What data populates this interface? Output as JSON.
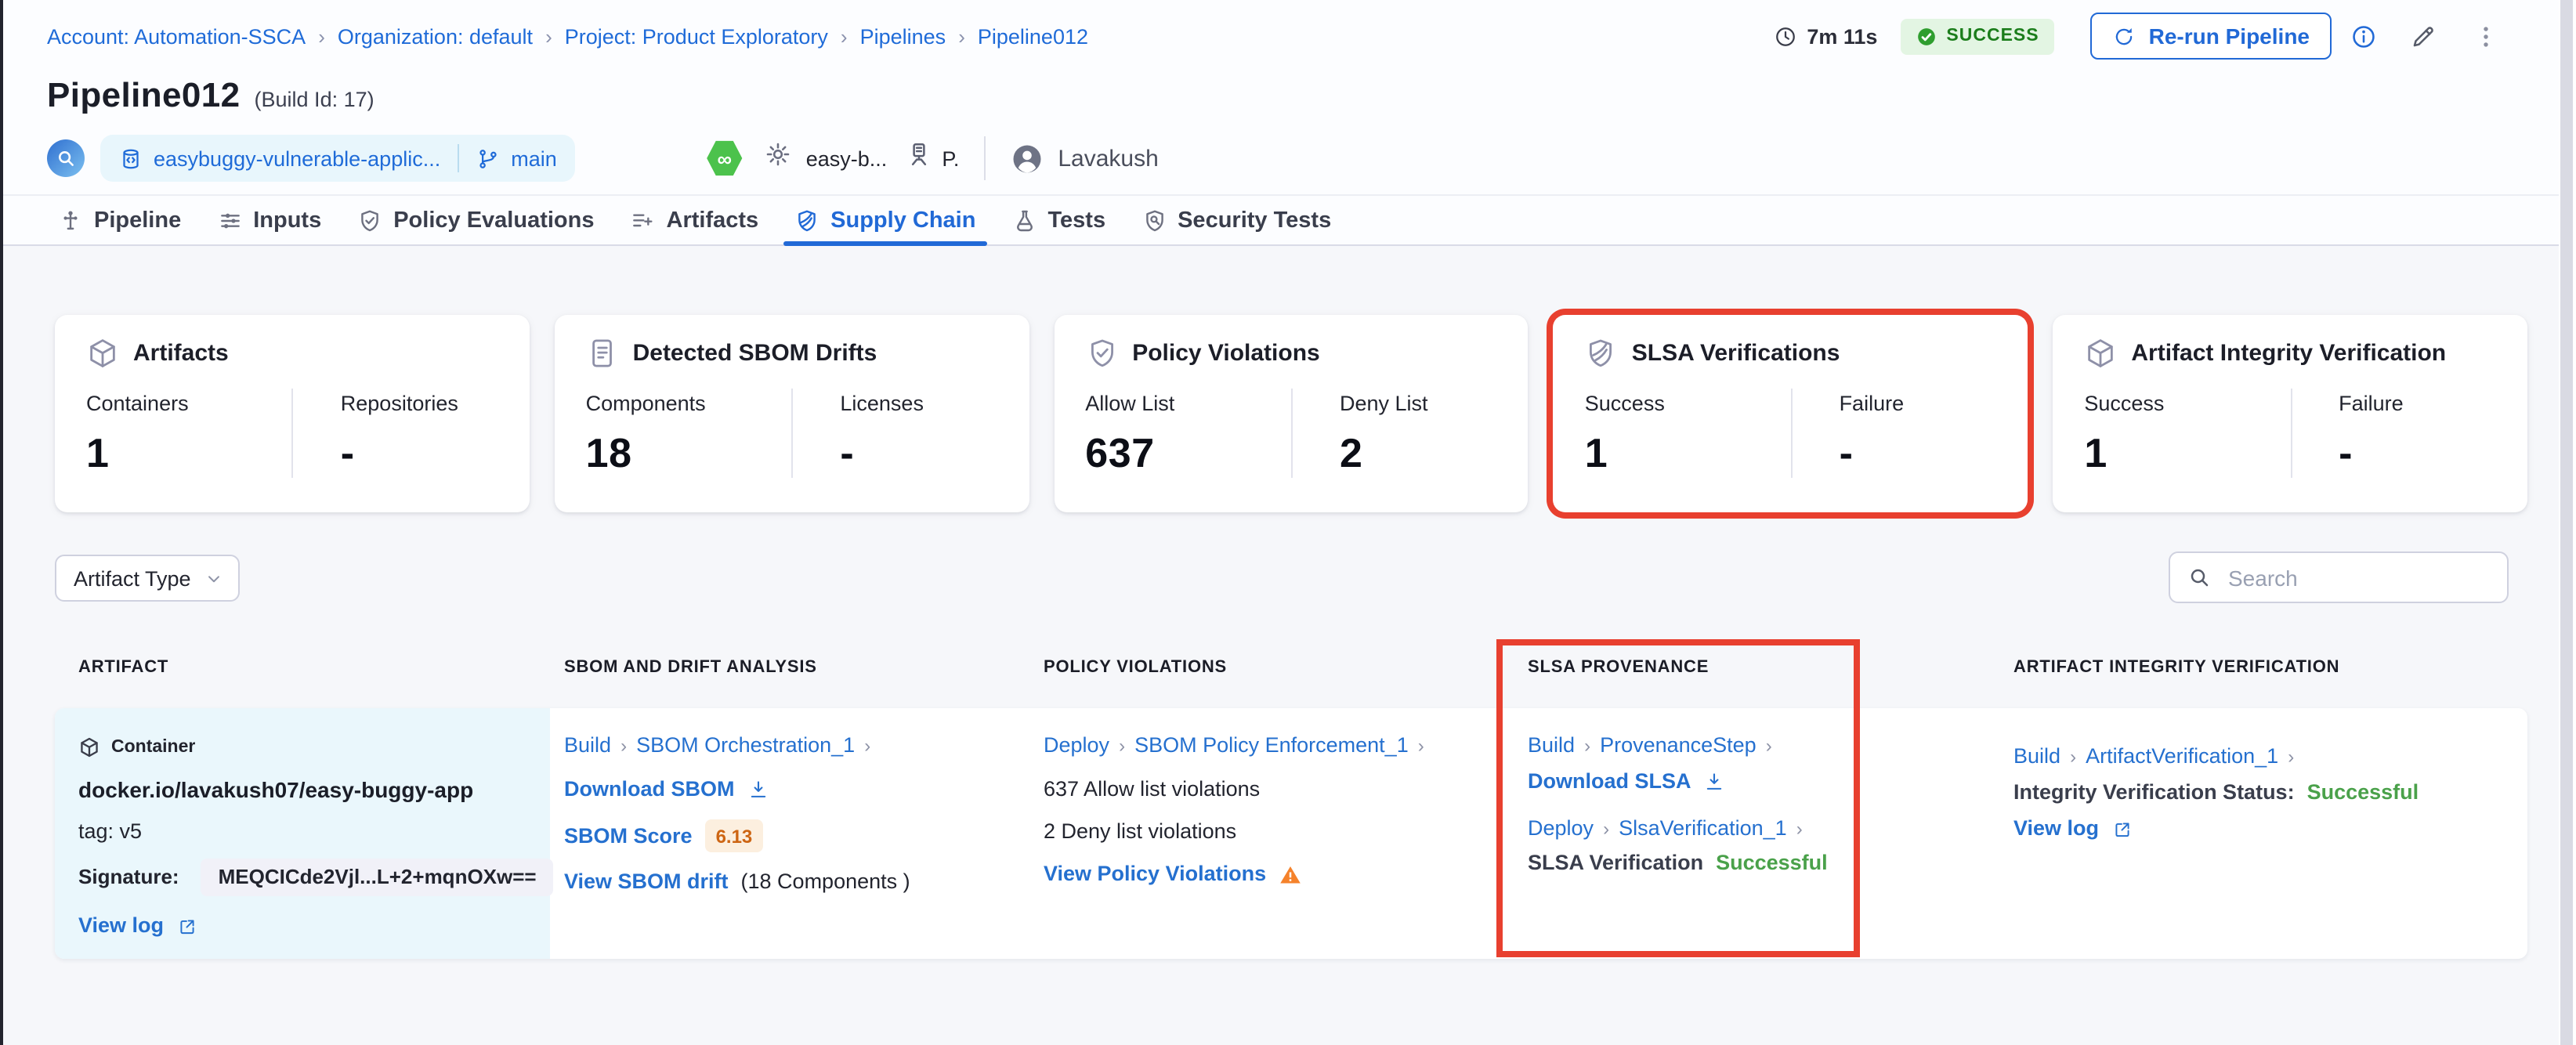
{
  "breadcrumb": {
    "separator": "›",
    "items": [
      {
        "label": "Account: Automation-SSCA"
      },
      {
        "label": "Organization: default"
      },
      {
        "label": "Project: Product Exploratory"
      },
      {
        "label": "Pipelines"
      },
      {
        "label": "Pipeline012"
      }
    ]
  },
  "topbar": {
    "duration": "7m 11s",
    "status_badge": "SUCCESS",
    "rerun_label": "Re-run Pipeline"
  },
  "header": {
    "title": "Pipeline012",
    "build_id": "(Build Id: 17)",
    "repo_name": "easybuggy-vulnerable-applic...",
    "branch": "main",
    "infinity_glyph": "∞",
    "trigger_service": "easy-b...",
    "infra_short": "P.",
    "user_name": "Lavakush"
  },
  "tabs": [
    {
      "label": "Pipeline"
    },
    {
      "label": "Inputs"
    },
    {
      "label": "Policy Evaluations"
    },
    {
      "label": "Artifacts"
    },
    {
      "label": "Supply Chain"
    },
    {
      "label": "Tests"
    },
    {
      "label": "Security Tests"
    }
  ],
  "cards": [
    {
      "title": "Artifacts",
      "m1_label": "Containers",
      "m1_value": "1",
      "m2_label": "Repositories",
      "m2_value": "-"
    },
    {
      "title": "Detected SBOM Drifts",
      "m1_label": "Components",
      "m1_value": "18",
      "m2_label": "Licenses",
      "m2_value": "-"
    },
    {
      "title": "Policy Violations",
      "m1_label": "Allow List",
      "m1_value": "637",
      "m2_label": "Deny List",
      "m2_value": "2"
    },
    {
      "title": "SLSA Verifications",
      "m1_label": "Success",
      "m1_value": "1",
      "m2_label": "Failure",
      "m2_value": "-"
    },
    {
      "title": "Artifact Integrity Verification",
      "m1_label": "Success",
      "m1_value": "1",
      "m2_label": "Failure",
      "m2_value": "-"
    }
  ],
  "filters": {
    "artifact_type": "Artifact Type",
    "search_placeholder": "Search"
  },
  "table": {
    "headers": {
      "artifact": "ARTIFACT",
      "sbom": "SBOM AND DRIFT ANALYSIS",
      "policy": "POLICY VIOLATIONS",
      "slsa": "SLSA PROVENANCE",
      "integrity": "ARTIFACT INTEGRITY VERIFICATION"
    },
    "row": {
      "artifact": {
        "badge": "Container",
        "name": "docker.io/lavakush07/easy-buggy-app",
        "tag": "tag: v5",
        "signature_label": "Signature:",
        "signature_value": "MEQCICde2Vjl...L+2+mqnOXw==",
        "view_log": "View log"
      },
      "sbom": {
        "stage": "Build",
        "step": "SBOM Orchestration_1",
        "download": "Download SBOM",
        "score_label": "SBOM Score",
        "score_value": "6.13",
        "drift_link": "View SBOM drift",
        "drift_count": "(18 Components )"
      },
      "policy": {
        "stage": "Deploy",
        "step": "SBOM Policy Enforcement_1",
        "allow": "637 Allow list violations",
        "deny": "2 Deny list violations",
        "view_link": "View Policy Violations"
      },
      "slsa": {
        "stage1": "Build",
        "step1": "ProvenanceStep",
        "download": "Download SLSA",
        "stage2": "Deploy",
        "step2": "SlsaVerification_1",
        "status_label": "SLSA Verification",
        "status_value": "Successful"
      },
      "integrity": {
        "stage": "Build",
        "step": "ArtifactVerification_1",
        "status_label": "Integrity Verification Status:",
        "status_value": "Successful",
        "view_log": "View log"
      }
    }
  },
  "colors": {
    "accent_blue": "#2169d6",
    "link_blue": "#2570cf",
    "highlight_red": "#e8402f",
    "success_green": "#4aa14a"
  }
}
